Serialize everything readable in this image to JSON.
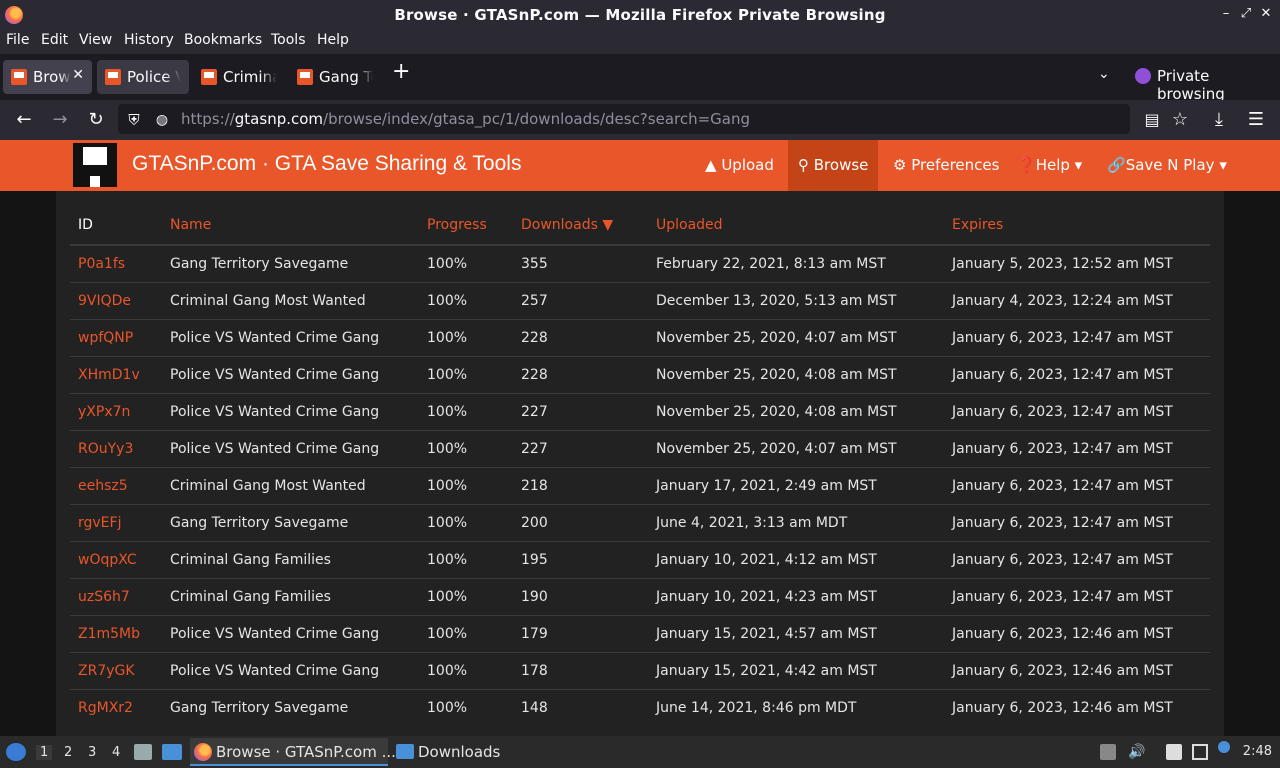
{
  "window": {
    "title": "Browse · GTASnP.com — Mozilla Firefox Private Browsing"
  },
  "menu": [
    "File",
    "Edit",
    "View",
    "History",
    "Bookmarks",
    "Tools",
    "Help"
  ],
  "tabs": [
    {
      "label": "Browse · GTASnP.com"
    },
    {
      "label": "Police VS Wanted Crime Gang"
    },
    {
      "label": "Criminal Gang Most Wanted"
    },
    {
      "label": "Gang Territory Savegame"
    }
  ],
  "private_label": "Private browsing",
  "url": {
    "scheme": "https://",
    "host": "gtasnp.com",
    "path": "/browse/index/gtasa_pc/1/downloads/desc?search=Gang"
  },
  "site": {
    "brand": "GTASnP.com · GTA Save Sharing & Tools",
    "nav": [
      "Upload",
      "Browse",
      "Preferences",
      "Help",
      "Save N Play"
    ],
    "accent": "#e8562a"
  },
  "table": {
    "headers": [
      "ID",
      "Name",
      "Progress",
      "Downloads",
      "Uploaded",
      "Expires"
    ],
    "rows": [
      [
        "P0a1fs",
        "Gang Territory Savegame",
        "100%",
        "355",
        "February 22, 2021, 8:13 am MST",
        "January 5, 2023, 12:52 am MST"
      ],
      [
        "9VIQDe",
        "Criminal Gang Most Wanted",
        "100%",
        "257",
        "December 13, 2020, 5:13 am MST",
        "January 4, 2023, 12:24 am MST"
      ],
      [
        "wpfQNP",
        "Police VS Wanted Crime Gang",
        "100%",
        "228",
        "November 25, 2020, 4:07 am MST",
        "January 6, 2023, 12:47 am MST"
      ],
      [
        "XHmD1v",
        "Police VS Wanted Crime Gang",
        "100%",
        "228",
        "November 25, 2020, 4:08 am MST",
        "January 6, 2023, 12:47 am MST"
      ],
      [
        "yXPx7n",
        "Police VS Wanted Crime Gang",
        "100%",
        "227",
        "November 25, 2020, 4:08 am MST",
        "January 6, 2023, 12:47 am MST"
      ],
      [
        "ROuYy3",
        "Police VS Wanted Crime Gang",
        "100%",
        "227",
        "November 25, 2020, 4:07 am MST",
        "January 6, 2023, 12:47 am MST"
      ],
      [
        "eehsz5",
        "Criminal Gang Most Wanted",
        "100%",
        "218",
        "January 17, 2021, 2:49 am MST",
        "January 6, 2023, 12:47 am MST"
      ],
      [
        "rgvEFj",
        "Gang Territory Savegame",
        "100%",
        "200",
        "June 4, 2021, 3:13 am MDT",
        "January 6, 2023, 12:47 am MST"
      ],
      [
        "wOqpXC",
        "Criminal Gang Families",
        "100%",
        "195",
        "January 10, 2021, 4:12 am MST",
        "January 6, 2023, 12:47 am MST"
      ],
      [
        "uzS6h7",
        "Criminal Gang Families",
        "100%",
        "190",
        "January 10, 2021, 4:23 am MST",
        "January 6, 2023, 12:47 am MST"
      ],
      [
        "Z1m5Mb",
        "Police VS Wanted Crime Gang",
        "100%",
        "179",
        "January 15, 2021, 4:57 am MST",
        "January 6, 2023, 12:46 am MST"
      ],
      [
        "ZR7yGK",
        "Police VS Wanted Crime Gang",
        "100%",
        "178",
        "January 15, 2021, 4:42 am MST",
        "January 6, 2023, 12:46 am MST"
      ],
      [
        "RgMXr2",
        "Gang Territory Savegame",
        "100%",
        "148",
        "June 14, 2021, 8:46 pm MDT",
        "January 6, 2023, 12:46 am MST"
      ]
    ]
  },
  "taskbar": {
    "workspaces": [
      "1",
      "2",
      "3",
      "4"
    ],
    "tasks": [
      "Browse · GTASnP.com ...",
      "Downloads"
    ],
    "clock": "2:48"
  }
}
